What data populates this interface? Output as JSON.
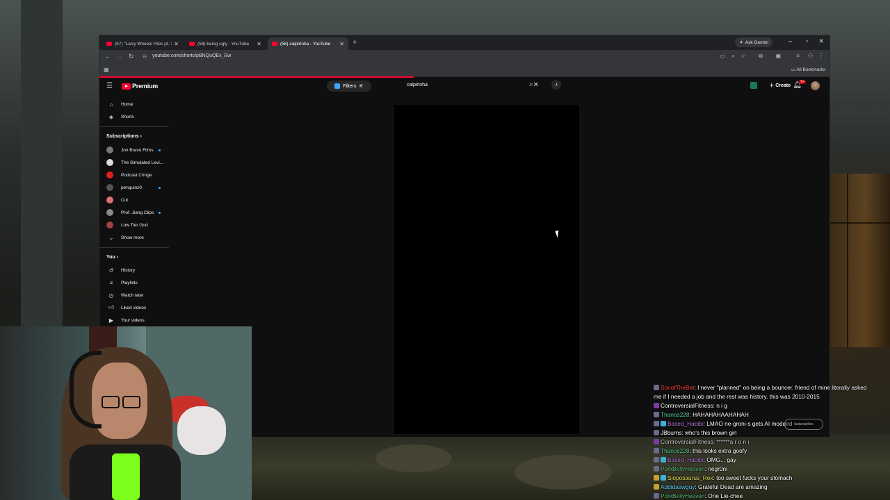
{
  "browser": {
    "tabs": [
      {
        "title": "(57) \"Larry Wheels Files pt. 2\" H",
        "active": false
      },
      {
        "title": "(58) being ugly - YouTube",
        "active": false
      },
      {
        "title": "(58) caipirinha - YouTube",
        "active": true
      }
    ],
    "new_tab": "+",
    "ask_gemini": "Ask Gemini",
    "url": "youtube.com/shorts/pBNQuQEx_Ew",
    "all_bookmarks": "All Bookmarks"
  },
  "youtube": {
    "logo_text": "Premium",
    "filters_label": "Filters",
    "search_value": "caipirinha",
    "create_label": "Create",
    "notification_count": "9+"
  },
  "sidebar": {
    "main": [
      {
        "icon": "home-icon",
        "label": "Home"
      },
      {
        "icon": "shorts-icon",
        "label": "Shorts"
      }
    ],
    "subscriptions_header": "Subscriptions",
    "subscriptions": [
      {
        "label": "Jon Bravo Films",
        "new": true,
        "color": "#777777"
      },
      {
        "label": "The Simulated Levi...",
        "new": false,
        "color": "#dddddd"
      },
      {
        "label": "Podcast Cringe",
        "new": false,
        "color": "#e02020"
      },
      {
        "label": "penguinz0",
        "new": true,
        "color": "#555555"
      },
      {
        "label": "Cut",
        "new": false,
        "color": "#e07070"
      },
      {
        "label": "Prof. Jiang Clips",
        "new": true,
        "color": "#8a8a8a"
      },
      {
        "label": "Low Tier God",
        "new": false,
        "color": "#a04040"
      }
    ],
    "show_more": "Show more",
    "you_header": "You",
    "you": [
      {
        "icon": "history-icon",
        "label": "History"
      },
      {
        "icon": "playlists-icon",
        "label": "Playlists"
      },
      {
        "icon": "watch-later-icon",
        "label": "Watch later"
      },
      {
        "icon": "liked-icon",
        "label": "Liked videos"
      },
      {
        "icon": "your-videos-icon",
        "label": "Your videos"
      }
    ]
  },
  "chat": {
    "messages": [
      {
        "user": "SonofTheBat",
        "user_color": "#ff4040",
        "text": "I never \"planned\" on being a bouncer. friend of mine literally asked"
      },
      {
        "user": "",
        "user_color": "#ffffff",
        "text": "me if I needed a job and the rest was history. this was 2010-2015"
      },
      {
        "user": "ControversialFitness",
        "user_color": "#ffffff",
        "text": "n i g"
      },
      {
        "user": "Thanos228",
        "user_color": "#56d39a",
        "text": "HAHAHAHAAHAHAH"
      },
      {
        "user": "Based_Habibi",
        "user_color": "#b37ad6",
        "text": "LMAO ne-groni-s gets AI modded"
      },
      {
        "user": "JBburns",
        "user_color": "#ffffff",
        "text": "who's this brown girl"
      },
      {
        "user": "ControversialFitness",
        "user_color": "#cccccc",
        "text": "******a r o n i"
      },
      {
        "user": "Thanos228",
        "user_color": "#56d39a",
        "text": "this looks extra goofy"
      },
      {
        "user": "Based_Habibi",
        "user_color": "#b37ad6",
        "text": "OMG... gay"
      },
      {
        "user": "PorkBellyHeaven",
        "user_color": "#5fbf7a",
        "text": "negr0ni"
      },
      {
        "user": "Sloposaurus_Rex",
        "user_color": "#e8e45a",
        "text": "too sweet fucks your stomach"
      },
      {
        "user": "Addidaswguy",
        "user_color": "#5cd0ff",
        "text": "Grateful Dead are amazing"
      },
      {
        "user": "PorkBellyHeaven",
        "user_color": "#5fbf7a",
        "text": "One Lie-chee"
      }
    ],
    "analytics_pill": "lastanalytics"
  },
  "colors": {
    "youtube_red": "#ff0033",
    "accent_blue": "#3ea6ff",
    "webcam_cup": "#7cff1a"
  }
}
